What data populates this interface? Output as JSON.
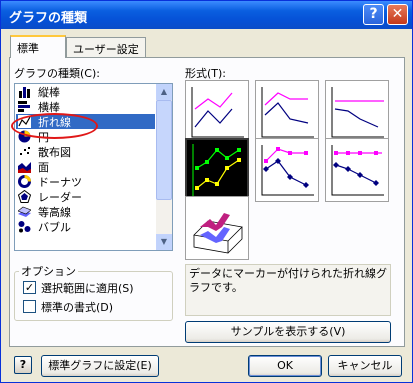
{
  "window": {
    "title": "グラフの種類",
    "help_glyph": "?",
    "close_glyph": "✕"
  },
  "tabs": [
    "標準",
    "ユーザー設定"
  ],
  "chart_type_label": "グラフの種類(C):",
  "chart_types": [
    {
      "label": "縦棒",
      "icon": "column-chart-icon"
    },
    {
      "label": "横棒",
      "icon": "bar-chart-icon"
    },
    {
      "label": "折れ線",
      "icon": "line-chart-icon",
      "selected": true
    },
    {
      "label": "円",
      "icon": "pie-chart-icon"
    },
    {
      "label": "散布図",
      "icon": "scatter-chart-icon"
    },
    {
      "label": "面",
      "icon": "area-chart-icon"
    },
    {
      "label": "ドーナツ",
      "icon": "donut-chart-icon"
    },
    {
      "label": "レーダー",
      "icon": "radar-chart-icon"
    },
    {
      "label": "等高線",
      "icon": "surface-chart-icon"
    },
    {
      "label": "バブル",
      "icon": "bubble-chart-icon"
    }
  ],
  "subtype_label": "形式(T):",
  "options": {
    "legend": "オプション",
    "apply_to_selection": {
      "label": "選択範囲に適用(S)",
      "checked": true
    },
    "default_formatting": {
      "label": "標準の書式(D)",
      "checked": false
    }
  },
  "description": "データにマーカーが付けられた折れ線グラフです。",
  "buttons": {
    "sample": "サンプルを表示する(V)",
    "set_default": "標準グラフに設定(E)",
    "ok": "OK",
    "cancel": "キャンセル"
  },
  "colors": {
    "selection": "#316ac5",
    "series_pink": "#ff00ff",
    "series_navy": "#000080",
    "series_green": "#00ff00",
    "series_yellow": "#ffff00",
    "annotation": "#e01818"
  }
}
